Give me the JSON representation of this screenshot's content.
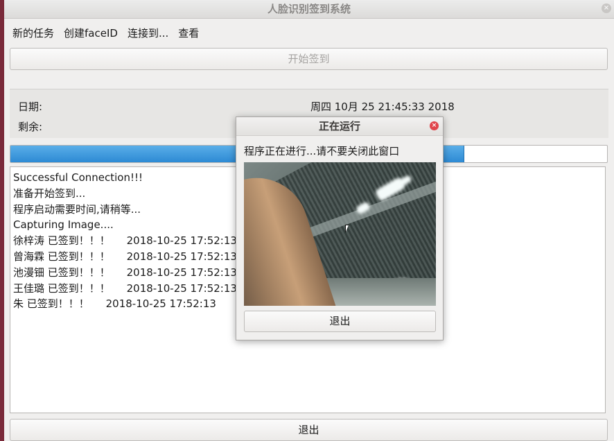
{
  "window": {
    "title": "人脸识别签到系统",
    "close_glyph": "×"
  },
  "menu": [
    "新的任务",
    "创建faceID",
    "连接到...",
    "查看"
  ],
  "start_button": {
    "label": "开始签到",
    "enabled": false
  },
  "info": {
    "date_label": "日期:",
    "date_value": "周四 10月 25 21:45:33 2018",
    "remaining_label": "剩余:"
  },
  "progress": {
    "fraction": 0.76,
    "color": "#2d8ad4"
  },
  "log": [
    "Successful Connection!!!",
    "准备开始签到...",
    "程序启动需要时间,请稍等...",
    "Capturing Image....",
    "徐梓涛 已签到！！！     2018-10-25 17:52:13",
    "曾海霖 已签到！！！     2018-10-25 17:52:13",
    "池漫钿 已签到！！！     2018-10-25 17:52:13",
    "王佳璐 已签到！！！     2018-10-25 17:52:13",
    "朱 已签到！！！     2018-10-25 17:52:13"
  ],
  "exit_button": {
    "label": "退出"
  },
  "dialog": {
    "title": "正在运行",
    "message": "程序正在进行...请不要关闭此窗口",
    "exit_label": "退出",
    "close_glyph": "×"
  }
}
